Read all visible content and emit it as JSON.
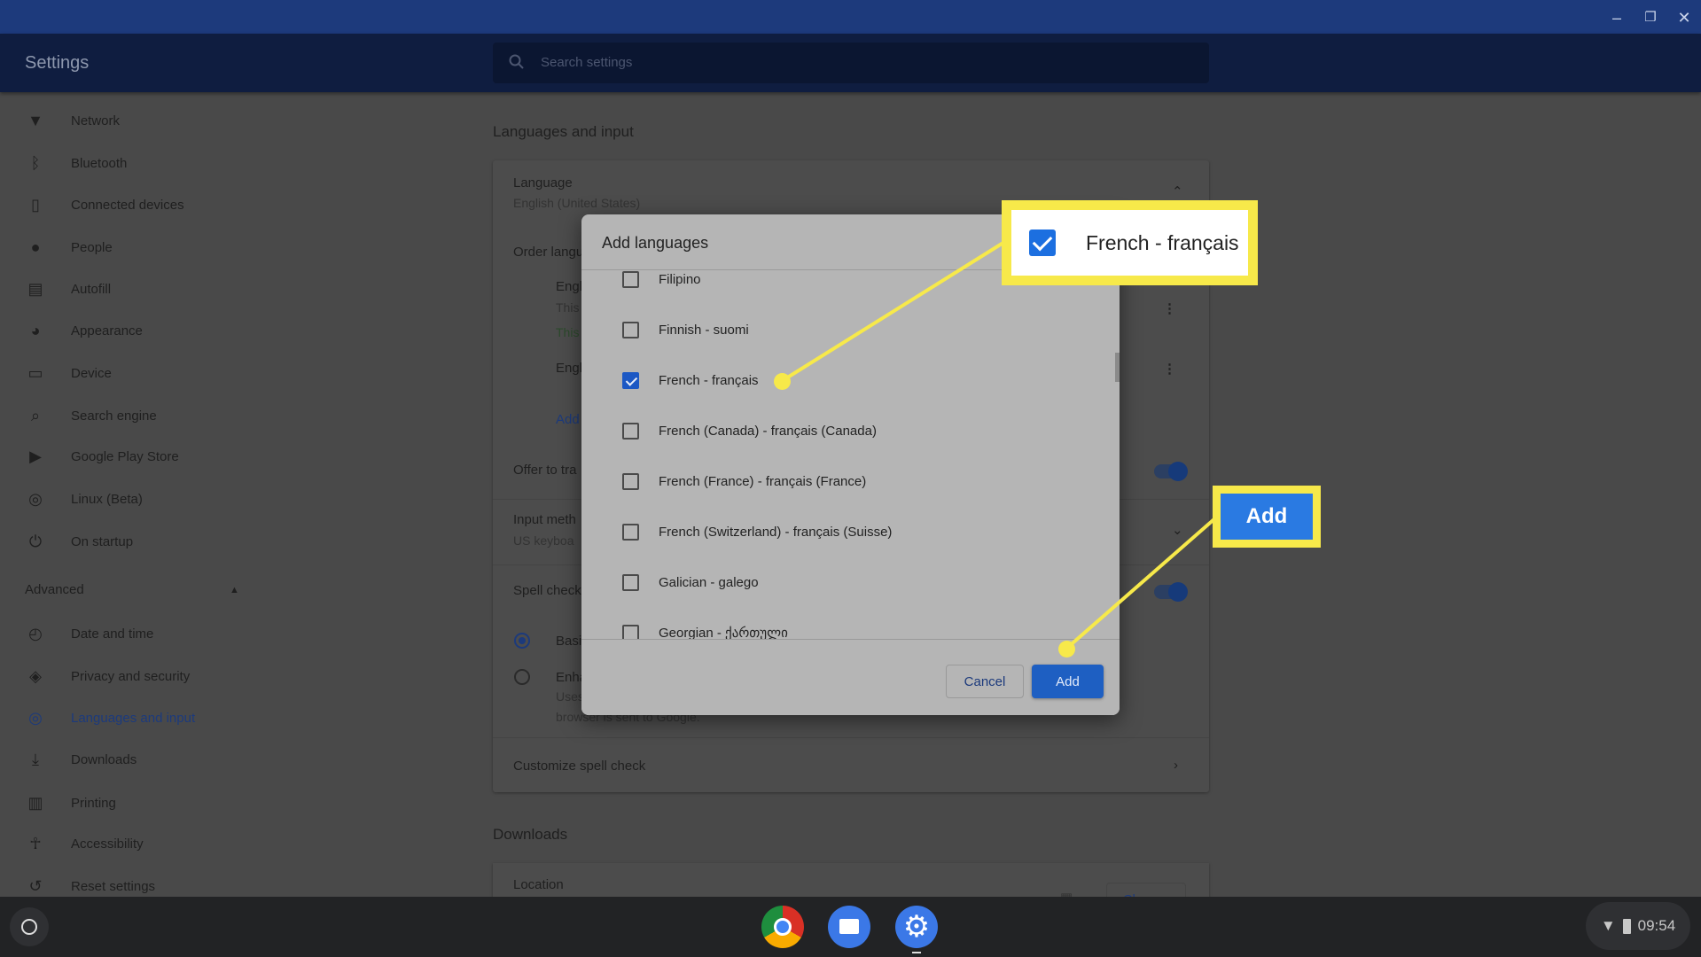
{
  "window": {
    "minimize": "minimize",
    "maximize": "maximize",
    "close": "close"
  },
  "header": {
    "title": "Settings",
    "search_placeholder": "Search settings"
  },
  "sidebar": {
    "items": [
      {
        "label": "Network",
        "icon": "wifi-icon"
      },
      {
        "label": "Bluetooth",
        "icon": "bluetooth-icon"
      },
      {
        "label": "Connected devices",
        "icon": "phone-icon"
      },
      {
        "label": "People",
        "icon": "person-icon"
      },
      {
        "label": "Autofill",
        "icon": "clipboard-icon"
      },
      {
        "label": "Appearance",
        "icon": "palette-icon"
      },
      {
        "label": "Device",
        "icon": "laptop-icon"
      },
      {
        "label": "Search engine",
        "icon": "search-icon"
      },
      {
        "label": "Google Play Store",
        "icon": "play-store-icon"
      },
      {
        "label": "Linux (Beta)",
        "icon": "linux-icon"
      },
      {
        "label": "On startup",
        "icon": "power-icon"
      }
    ],
    "advanced_label": "Advanced",
    "advanced_items": [
      {
        "label": "Date and time",
        "icon": "clock-icon"
      },
      {
        "label": "Privacy and security",
        "icon": "shield-icon"
      },
      {
        "label": "Languages and input",
        "icon": "globe-icon",
        "active": true
      },
      {
        "label": "Downloads",
        "icon": "download-icon"
      },
      {
        "label": "Printing",
        "icon": "printer-icon"
      },
      {
        "label": "Accessibility",
        "icon": "accessibility-icon"
      },
      {
        "label": "Reset settings",
        "icon": "reset-icon"
      }
    ]
  },
  "main": {
    "section_title": "Languages and input",
    "language_label": "Language",
    "language_value": "English (United States)",
    "order_label": "Order langu",
    "lang1": "Engl",
    "lang1_sub1": "This",
    "lang1_sub2": "This",
    "lang2": "Engl",
    "add_link": "Add",
    "offer_translate": "Offer to tra",
    "input_method": "Input meth",
    "input_method_value": "US keyboa",
    "spell_check": "Spell check",
    "basic": "Basi",
    "enhanced": "Enha",
    "enhanced_sub1": "Uses",
    "enhanced_sub2": "browser is sent to Google.",
    "customize": "Customize spell check",
    "downloads_title": "Downloads",
    "location": "Location",
    "change": "Change"
  },
  "dialog": {
    "title": "Add languages",
    "items": [
      {
        "label": "Filipino",
        "checked": false
      },
      {
        "label": "Finnish - suomi",
        "checked": false
      },
      {
        "label": "French - français",
        "checked": true
      },
      {
        "label": "French (Canada) - français (Canada)",
        "checked": false
      },
      {
        "label": "French (France) - français (France)",
        "checked": false
      },
      {
        "label": "French (Switzerland) - français (Suisse)",
        "checked": false
      },
      {
        "label": "Galician - galego",
        "checked": false
      },
      {
        "label": "Georgian - ქართული",
        "checked": false
      }
    ],
    "cancel": "Cancel",
    "add": "Add"
  },
  "callouts": {
    "checkbox_label": "French - français",
    "add_label": "Add",
    "color": "#f7e94a"
  },
  "tray": {
    "time": "09:54"
  },
  "colors": {
    "accent": "#1e5fc2",
    "callout": "#f7e94a"
  }
}
